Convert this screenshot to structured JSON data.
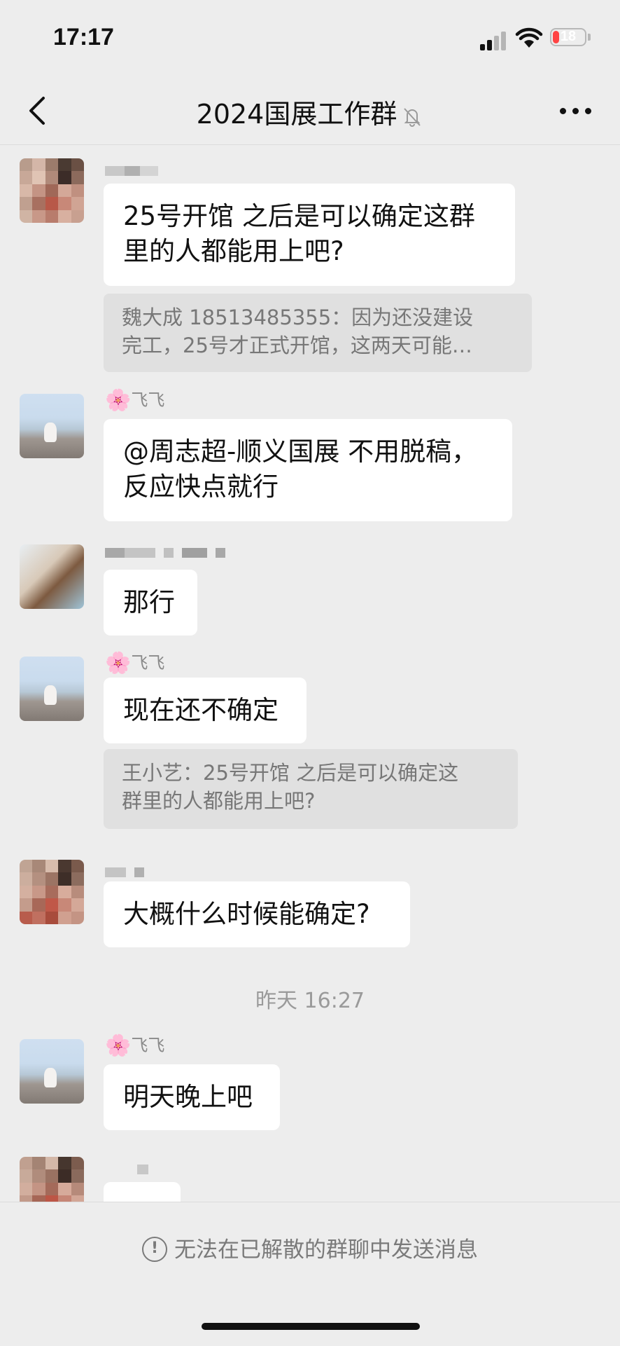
{
  "status_bar": {
    "time": "17:17",
    "battery": "18"
  },
  "header": {
    "title": "2024国展工作群",
    "back_icon": "chevron-left-icon",
    "mute_icon": "bell-slash-icon",
    "more_icon": "more-dots-icon"
  },
  "messages": [
    {
      "sender": "",
      "text_lines": [
        "25号开馆 之后是可以确定这群",
        "里的人都能用上吧?"
      ],
      "quote_lines": [
        "魏大成  18513485355：因为还没建设",
        "完工，25号才正式开馆，这两天可能…"
      ]
    },
    {
      "sender": "飞飞",
      "sender_emoji": "🌸",
      "text_lines": [
        "@周志超-顺义国展 不用脱稿，",
        "反应快点就行"
      ]
    },
    {
      "sender": "",
      "text_lines": [
        "那行"
      ]
    },
    {
      "sender": "飞飞",
      "sender_emoji": "🌸",
      "text_lines": [
        "现在还不确定"
      ],
      "quote_lines": [
        "王小艺：25号开馆 之后是可以确定这",
        "群里的人都能用上吧?"
      ]
    },
    {
      "sender": "",
      "text_lines": [
        "大概什么时候能确定?"
      ]
    },
    {
      "timestamp": "昨天 16:27"
    },
    {
      "sender": "飞飞",
      "sender_emoji": "🌸",
      "text_lines": [
        "明天晚上吧"
      ]
    },
    {
      "sender": "",
      "text_lines": [
        "✌"
      ]
    }
  ],
  "footer": {
    "notice": "无法在已解散的群聊中发送消息",
    "info_icon": "info-circle-icon"
  }
}
